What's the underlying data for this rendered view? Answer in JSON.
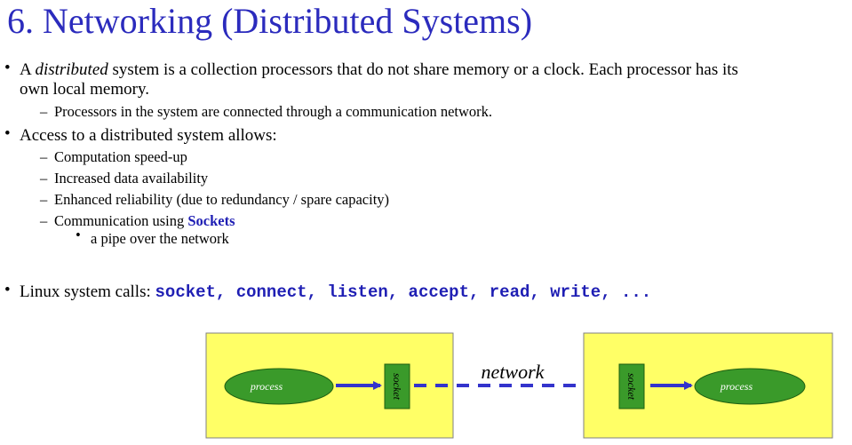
{
  "slide": {
    "title": "6. Networking (Distributed Systems)",
    "bullet1": {
      "prefix": "A ",
      "emphasis": "distributed",
      "line1_rest": " system is a collection processors that do not share memory or a clock. Each processor has its",
      "line2": "own local memory.",
      "sub": "Processors in the system are connected through a communication network."
    },
    "bullet2": {
      "text": "Access to a distributed system allows:",
      "subs": [
        "Computation speed-up",
        "Increased data availability",
        "Enhanced reliability (due to redundancy / spare capacity)"
      ],
      "sockets_prefix": "Communication using ",
      "sockets_word": "Sockets",
      "sockets_sub": "a pipe over the network"
    },
    "bullet3": {
      "label": "Linux system calls: ",
      "calls": "socket, connect, listen, accept, read, write, ..."
    },
    "diagram": {
      "left_process": "process",
      "left_socket": "socket",
      "network": "network",
      "right_socket": "socket",
      "right_process": "process"
    },
    "colors": {
      "title": "#2b2bbd",
      "box_fill": "#ffff66",
      "process_fill": "#3a9a2a",
      "arrow": "#3333cc"
    }
  }
}
